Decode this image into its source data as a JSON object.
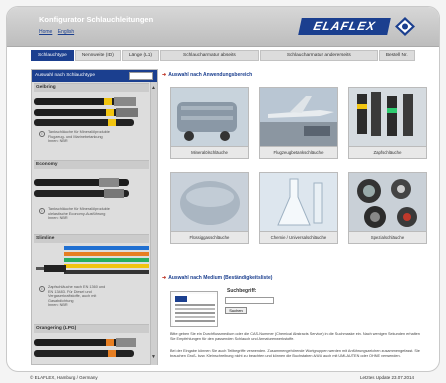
{
  "header": {
    "title": "Konfigurator Schlauchleitungen",
    "nav_links": [
      "Home",
      "English"
    ],
    "logo_text": "ELAFLEX"
  },
  "tabs": [
    {
      "label": "Schlauchtype",
      "active": true
    },
    {
      "label": "Nennweite (ID)",
      "active": false
    },
    {
      "label": "Länge (L1)",
      "active": false
    },
    {
      "label": "Schlaucharmatur abseits",
      "active": false
    },
    {
      "label": "Schlaucharmatur andererseits",
      "active": false
    },
    {
      "label": "Bestell Nr.",
      "active": false
    }
  ],
  "sidebar": {
    "heading": "Auswahl nach Schlauchtype",
    "products": [
      {
        "name": "Gelbring",
        "desc": [
          "Tankschläuche für Mineralölprodukte",
          "Flugzeug- und Marinebetankung",
          "Innen: NBR"
        ]
      },
      {
        "name": "Economy",
        "desc": [
          "Tankschläuche für Mineralölprodukte",
          "ulelastische Economy-Ausführung",
          "Innen: NBR"
        ]
      },
      {
        "name": "Slimline",
        "desc": [
          "Zapfschläuche nach EN 1360 und",
          "EN 13483. Für Diesel und",
          "Vergaserkraftstoffe, auch mit",
          "Gasabdichtung",
          "Innen: NBR"
        ]
      },
      {
        "name": "Orangering (LPG)",
        "desc": []
      }
    ]
  },
  "main": {
    "section_app": "Auswahl nach Anwendungsbereich",
    "categories": [
      "Mineralölschläuche",
      "Flugzeugbetankschläuche",
      "Zapfschläuche",
      "Flüssiggasschläuche",
      "Chemie / Universalschläuche",
      "Spezialschläuche"
    ],
    "section_medium": "Auswahl nach Medium (Beständigkeitsliste)",
    "search_label": "Suchbegriff:",
    "search_button": "Suchen",
    "para1": "Bitte geben Sie ein Durchflussmedium oder die CAS-Nummer (Chemical Abstracts Service) in die Suchmaske ein. Nach wenigen Sekunden erhalten Sie Empfehlungen für den passenden Schlauch und Armaturenwerkstoffe.",
    "para2": "Bei der Eingabe können Sie auch Teilbegriffe verwenden. Zusammengehörende Wortgruppen werden mit Anführungszeichen zusammengefasst. Sie brauchen Groß- bzw. Kleinschreibung nicht zu beachten und können die Buchstaben ä/ö/ü auch mit UMLAUTEN oder OHNE verwenden."
  },
  "footer": {
    "left": "© ELAFLEX, Hamburg / Germany",
    "right": "Letztes Update 23.07.2014"
  },
  "colors": {
    "brand": "#1b3f8f",
    "accent": "#c0392b"
  }
}
